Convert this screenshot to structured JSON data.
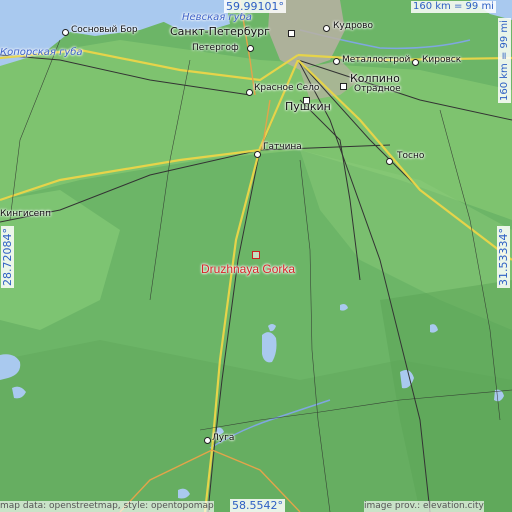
{
  "map": {
    "center_place": "Druzhnaya Gorka",
    "coordinates": {
      "top_lat": "59.99101°",
      "bottom_lat": "58.5542°",
      "left_lon": "28.72084°",
      "right_lon": "31.53334°"
    },
    "scale": {
      "top": "160 km = 99 mi",
      "right": "160 km = 99 mi"
    },
    "places": {
      "sankt_peterburg": "Санкт-Петербург",
      "kudrovo": "Кудрово",
      "sosnovyi_bor": "Сосновый Бор",
      "peterhof": "Петергоф",
      "kirovsk": "Кировск",
      "metallostroy": "Металлострой",
      "kolpino": "Колпино",
      "otradnoe": "Отрадное",
      "krasnoe_selo": "Красное Село",
      "pushkin": "Пушкин",
      "gatchina": "Гатчина",
      "tosno": "Тосно",
      "kingisepp": "Кингисепп",
      "luga": "Луга"
    },
    "water": {
      "neva_bay": "Невская губа",
      "koporye_bay": "Копорская губа"
    },
    "credits": {
      "left": "map data: openstreetmap, style: opentopomap",
      "right": "image prov.: elevation.city"
    },
    "colors": {
      "land": "#6fb86a",
      "lowland": "#8fd07a",
      "water": "#a9c9ef",
      "marker": "#d7262a",
      "coords": "#2d5fc4"
    }
  }
}
